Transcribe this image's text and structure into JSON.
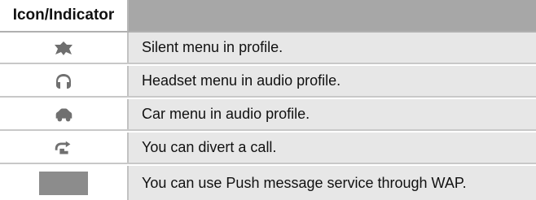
{
  "table": {
    "header": {
      "icon_column": "Icon/Indicator"
    },
    "rows": [
      {
        "icon": "silent-profile-icon",
        "description": "Silent menu in profile."
      },
      {
        "icon": "headset-icon",
        "description": "Headset menu in audio profile."
      },
      {
        "icon": "car-icon",
        "description": "Car menu in audio profile."
      },
      {
        "icon": "divert-call-icon",
        "description": "You can divert a call."
      },
      {
        "icon": "push-message-icon",
        "description": "You can use Push message service through WAP."
      }
    ]
  }
}
